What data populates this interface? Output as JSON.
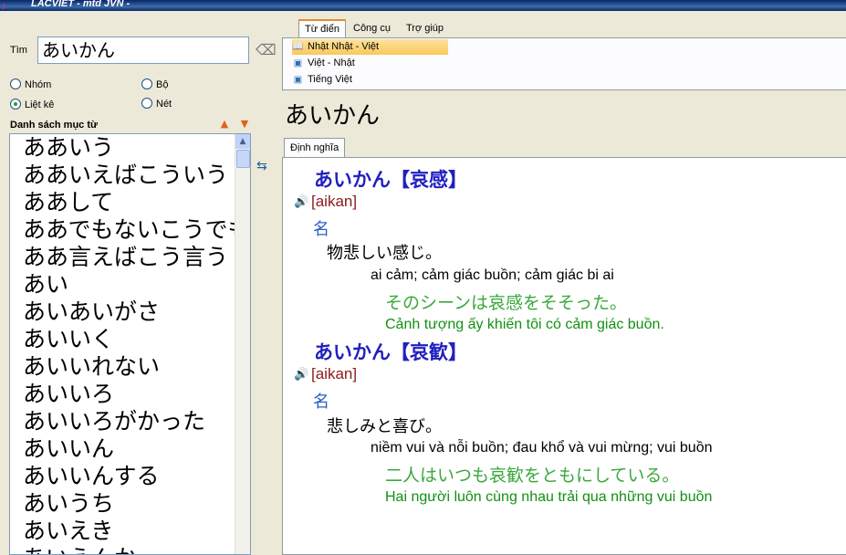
{
  "window": {
    "title": "LACVIET - mtd JVN -"
  },
  "search": {
    "label": "Tìm",
    "value": "あいかん"
  },
  "options": {
    "nhom": "Nhóm",
    "bo": "Bộ",
    "liet_ke": "Liệt kê",
    "net": "Nét",
    "selected": "Liệt kê"
  },
  "wordlist": {
    "title": "Danh sách mục từ",
    "items": [
      "ああいう",
      "ああいえばこういう",
      "ああして",
      "ああでもないこうでもない",
      "ああ言えばこう言う",
      "あい",
      "あいあいがさ",
      "あいいく",
      "あいいれない",
      "あいいろ",
      "あいいろがかった",
      "あいいん",
      "あいいんする",
      "あいうち",
      "あいえき",
      "あいえんか"
    ]
  },
  "menu": {
    "tabs": [
      "Từ điển",
      "Công cụ",
      "Trợ giúp"
    ]
  },
  "dictionaries": [
    {
      "label": "Nhật Nhật - Việt",
      "selected": true
    },
    {
      "label": "Việt - Nhật",
      "selected": false
    },
    {
      "label": "Tiếng Việt",
      "selected": false
    }
  ],
  "headword": "あいかん",
  "definition_tab": "Định nghĩa",
  "entries": [
    {
      "headword": "あいかん【哀感】",
      "reading": "[aikan]",
      "pos": "名",
      "jp_definition": "物悲しい感じ。",
      "vi_definition": "ai cảm; cảm giác buồn; cảm giác bi ai",
      "jp_example": "そのシーンは哀感をそそった。",
      "vi_example": "Cảnh tượng ấy khiến tôi có cảm giác buồn."
    },
    {
      "headword": "あいかん【哀歓】",
      "reading": "[aikan]",
      "pos": "名",
      "jp_definition": "悲しみと喜び。",
      "vi_definition": "niềm vui và nỗi buồn; đau khổ và vui mừng; vui buồn",
      "jp_example": "二人はいつも哀歓をともにしている。",
      "vi_example": "Hai người luôn cùng nhau trải qua những vui buồn"
    }
  ]
}
